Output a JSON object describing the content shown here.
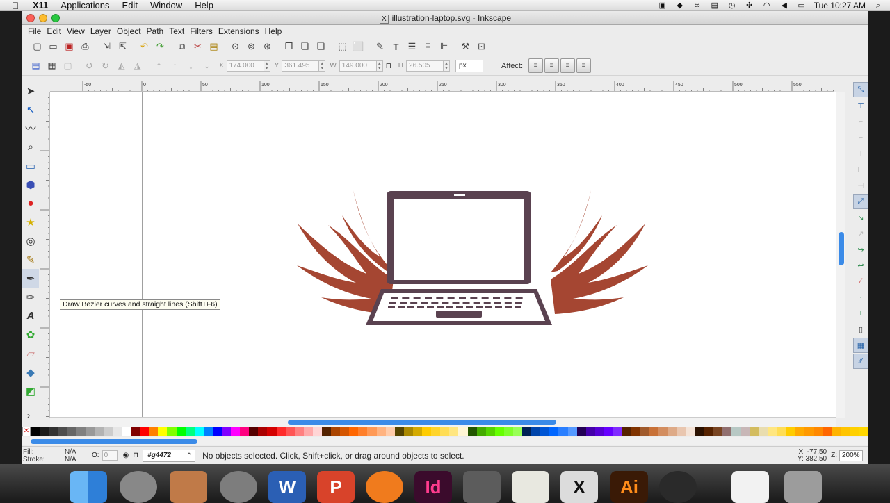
{
  "macbar": {
    "app": "X11",
    "menus": [
      "Applications",
      "Edit",
      "Window",
      "Help"
    ],
    "clock": "Tue 10:27 AM"
  },
  "window": {
    "title": "illustration-laptop.svg - Inkscape"
  },
  "menubar": [
    "File",
    "Edit",
    "View",
    "Layer",
    "Object",
    "Path",
    "Text",
    "Filters",
    "Extensions",
    "Help"
  ],
  "controls": {
    "x_label": "X",
    "x_value": "174.000",
    "y_label": "Y",
    "y_value": "361.495",
    "w_label": "W",
    "w_value": "149.000",
    "h_label": "H",
    "h_value": "26.505",
    "unit": "px",
    "affect_label": "Affect:"
  },
  "ruler": {
    "h_labels": [
      "-50",
      "0",
      "50",
      "100",
      "150",
      "200",
      "250",
      "300",
      "350",
      "400",
      "450",
      "500",
      "550"
    ]
  },
  "tooltip": "Draw Bezier curves and straight lines (Shift+F6)",
  "status": {
    "fill_label": "Fill:",
    "fill_value": "N/A",
    "stroke_label": "Stroke:",
    "stroke_value": "N/A",
    "opacity_label": "O:",
    "opacity_value": "0",
    "layer": "#g4472",
    "message": "No objects selected. Click, Shift+click, or drag around objects to select.",
    "coord_x": "X: -77.50",
    "coord_y": "Y: 382.50",
    "zoom_label": "Z:",
    "zoom_value": "200%"
  },
  "dock_labels": [
    "W",
    "Id",
    "Ai"
  ],
  "colors": {
    "wing": "#a54632",
    "laptop": "#5a4250",
    "accent": "#3b8be8"
  },
  "palette": [
    "#000000",
    "#1a1a1a",
    "#333333",
    "#4d4d4d",
    "#666666",
    "#808080",
    "#999999",
    "#b3b3b3",
    "#cccccc",
    "#e6e6e6",
    "#ffffff",
    "#800000",
    "#ff0000",
    "#ff8000",
    "#ffff00",
    "#80ff00",
    "#00ff00",
    "#00ff80",
    "#00ffff",
    "#0080ff",
    "#0000ff",
    "#8000ff",
    "#ff00ff",
    "#ff0080",
    "#550000",
    "#aa0000",
    "#d40000",
    "#ff2a2a",
    "#ff5555",
    "#ff8080",
    "#ffaaaa",
    "#ffd5d5",
    "#552200",
    "#aa4400",
    "#d45500",
    "#ff6600",
    "#ff7f2a",
    "#ff9955",
    "#ffb380",
    "#ffccaa",
    "#554400",
    "#aa8800",
    "#d4aa00",
    "#ffcc00",
    "#ffd42a",
    "#ffdd55",
    "#ffe680",
    "#fff6d5",
    "#225500",
    "#44aa00",
    "#55d400",
    "#66ff00",
    "#7fff2a",
    "#99ff55",
    "#002255",
    "#0044aa",
    "#0055d4",
    "#0066ff",
    "#2a7fff",
    "#5599ff",
    "#220055",
    "#4400aa",
    "#5500d4",
    "#6600ff",
    "#7f2aff",
    "#552200",
    "#803300",
    "#a05a2c",
    "#c87137",
    "#d38d5f",
    "#deaa87",
    "#e9c6af",
    "#f4e3d7",
    "#2b1100",
    "#552200",
    "#784421",
    "#916f6f",
    "#b7c8c4",
    "#c8b7b7",
    "#d3bc5f",
    "#e9ddaf",
    "#ffe680",
    "#ffdd55",
    "#ffcc00",
    "#ffaa00",
    "#ff9900",
    "#ff8800",
    "#ff6600",
    "#ffb300",
    "#ffc400",
    "#ffd000",
    "#ffd700"
  ]
}
